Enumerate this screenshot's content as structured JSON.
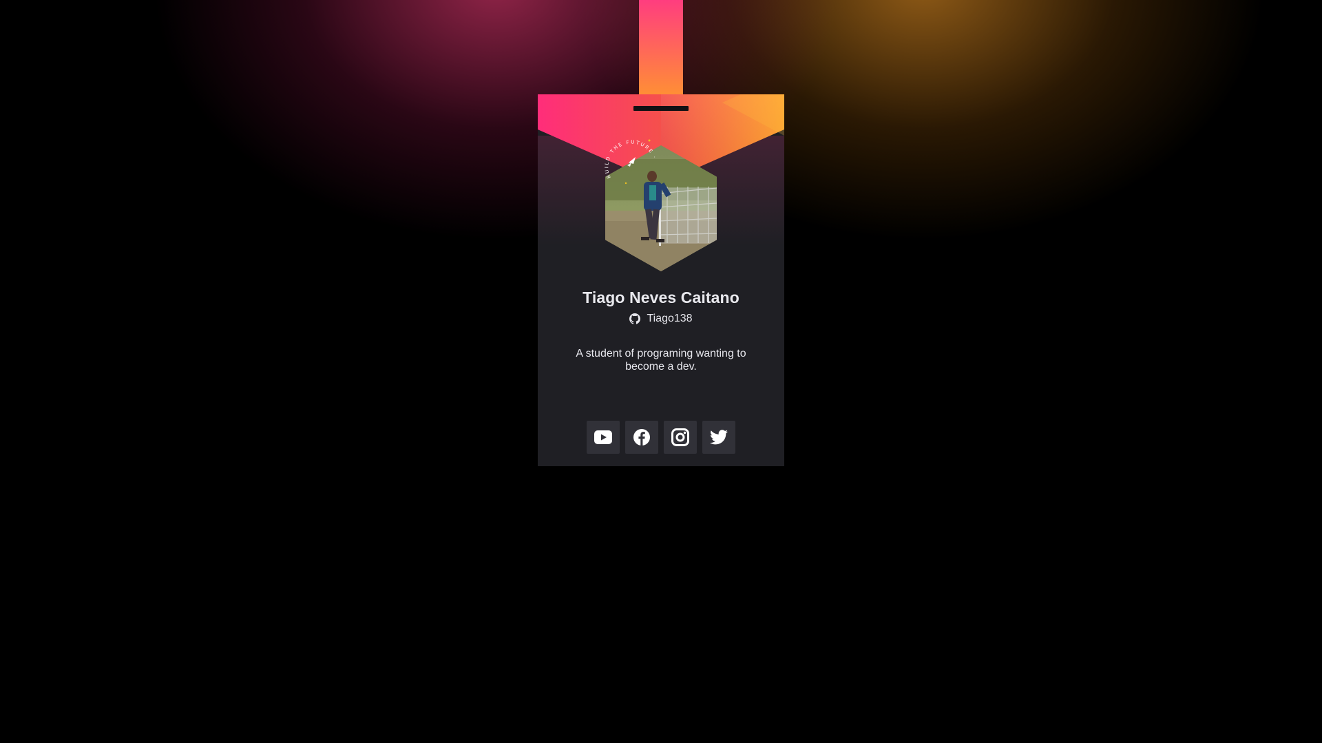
{
  "profile": {
    "name": "Tiago Neves Caitano",
    "github_username": "Tiago138",
    "bio": "A student of programing wanting to become a dev.",
    "seal_text": "BUILD THE FUTURE · ROCKETSEAT ·"
  },
  "socials": [
    {
      "name": "youtube",
      "icon": "youtube-icon"
    },
    {
      "name": "facebook",
      "icon": "facebook-icon"
    },
    {
      "name": "instagram",
      "icon": "instagram-icon"
    },
    {
      "name": "twitter",
      "icon": "twitter-icon"
    }
  ],
  "colors": {
    "background": "#000000",
    "card": "#1f1f24",
    "social_button": "#313138",
    "gradient_start": "#ff2d7a",
    "gradient_end": "#ffa22c",
    "text": "#e9e9ee"
  }
}
